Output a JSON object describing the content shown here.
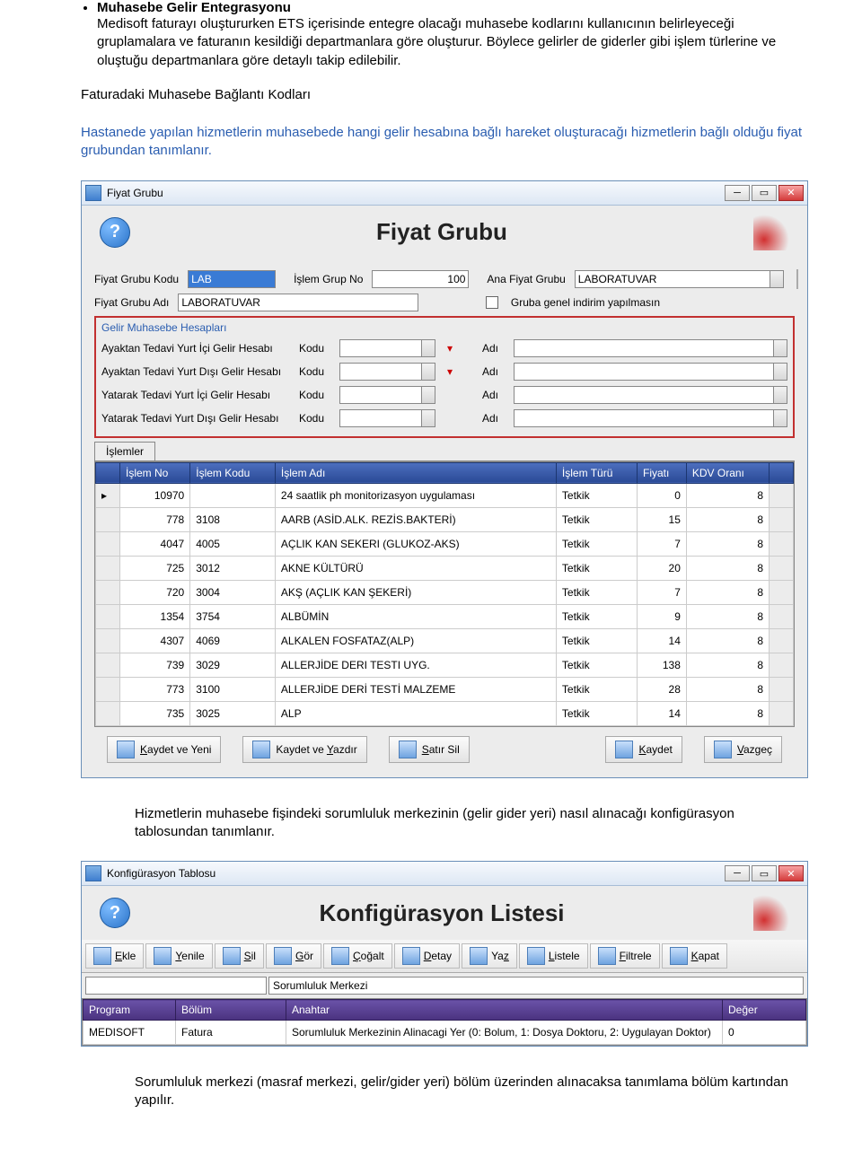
{
  "doc": {
    "heading": "Muhasebe Gelir Entegrasyonu",
    "para1": "Medisoft faturayı oluştururken ETS içerisinde entegre olacağı muhasebe kodlarını kullanıcının belirleyeceği gruplamalara ve faturanın kesildiği departmanlara göre oluşturur. Böylece gelirler de giderler gibi işlem türlerine ve oluştuğu departmanlara göre detaylı takip edilebilir.",
    "para2": "Faturadaki Muhasebe Bağlantı Kodları",
    "para3": "Hastanede yapılan hizmetlerin muhasebede hangi gelir hesabına bağlı hareket oluşturacağı hizmetlerin bağlı olduğu fiyat grubundan tanımlanır.",
    "para4": "Hizmetlerin muhasebe fişindeki sorumluluk merkezinin (gelir gider yeri) nasıl alınacağı konfigürasyon tablosundan tanımlanır.",
    "para5": "Sorumluluk merkezi (masraf merkezi, gelir/gider yeri) bölüm üzerinden alınacaksa tanımlama bölüm kartından yapılır."
  },
  "win1": {
    "title": "Fiyat Grubu",
    "bigTitle": "Fiyat Grubu",
    "labels": {
      "fiyatGrubuKodu": "Fiyat Grubu Kodu",
      "islemGrupNo": "İşlem Grup No",
      "anaFiyatGrubu": "Ana Fiyat Grubu",
      "fiyatGrubuAdi": "Fiyat Grubu Adı",
      "grubaIndirim": "Gruba genel indirim yapılmasın",
      "gelirHesaplari": "Gelir Muhasebe Hesapları",
      "ayaktanIci": "Ayaktan Tedavi Yurt İçi Gelir Hesabı",
      "ayaktanDisi": "Ayaktan Tedavi Yurt Dışı Gelir Hesabı",
      "yatarakIci": "Yatarak Tedavi Yurt İçi Gelir Hesabı",
      "yatarakDisi": "Yatarak Tedavi Yurt Dışı Gelir Hesabı",
      "kodu": "Kodu",
      "adi": "Adı",
      "islemler": "İşlemler"
    },
    "values": {
      "kodu": "LAB",
      "islemGrupNo": "100",
      "anaFiyatGrubu": "LABORATUVAR",
      "adi": "LABORATUVAR"
    },
    "gridHeaders": {
      "islemNo": "İşlem No",
      "islemKodu": "İşlem Kodu",
      "islemAdi": "İşlem Adı",
      "islemTuru": "İşlem Türü",
      "fiyati": "Fiyatı",
      "kdvOrani": "KDV Oranı"
    },
    "rows": [
      {
        "no": "10970",
        "kodu": "",
        "adi": "24 saatlik ph monitorizasyon uygulaması",
        "turu": "Tetkik",
        "fiyat": "0",
        "kdv": "8"
      },
      {
        "no": "778",
        "kodu": "3108",
        "adi": "AARB (ASİD.ALK. REZİS.BAKTERİ)",
        "turu": "Tetkik",
        "fiyat": "15",
        "kdv": "8"
      },
      {
        "no": "4047",
        "kodu": "4005",
        "adi": "AÇLIK KAN SEKERI (GLUKOZ-AKS)",
        "turu": "Tetkik",
        "fiyat": "7",
        "kdv": "8"
      },
      {
        "no": "725",
        "kodu": "3012",
        "adi": "AKNE KÜLTÜRÜ",
        "turu": "Tetkik",
        "fiyat": "20",
        "kdv": "8"
      },
      {
        "no": "720",
        "kodu": "3004",
        "adi": "AKŞ (AÇLIK KAN ŞEKERİ)",
        "turu": "Tetkik",
        "fiyat": "7",
        "kdv": "8"
      },
      {
        "no": "1354",
        "kodu": "3754",
        "adi": "ALBÜMİN",
        "turu": "Tetkik",
        "fiyat": "9",
        "kdv": "8"
      },
      {
        "no": "4307",
        "kodu": "4069",
        "adi": "ALKALEN FOSFATAZ(ALP)",
        "turu": "Tetkik",
        "fiyat": "14",
        "kdv": "8"
      },
      {
        "no": "739",
        "kodu": "3029",
        "adi": "ALLERJİDE DERI TESTI UYG.",
        "turu": "Tetkik",
        "fiyat": "138",
        "kdv": "8"
      },
      {
        "no": "773",
        "kodu": "3100",
        "adi": "ALLERJİDE DERİ TESTİ MALZEME",
        "turu": "Tetkik",
        "fiyat": "28",
        "kdv": "8"
      },
      {
        "no": "735",
        "kodu": "3025",
        "adi": "ALP",
        "turu": "Tetkik",
        "fiyat": "14",
        "kdv": "8"
      }
    ],
    "buttons": {
      "kaydetYeni": "Kaydet ve Yeni",
      "kaydetYazdir": "Kaydet ve Yazdır",
      "satirSil": "Satır Sil",
      "kaydet": "Kaydet",
      "vazgec": "Vazgeç"
    }
  },
  "win2": {
    "title": "Konfigürasyon Tablosu",
    "bigTitle": "Konfigürasyon Listesi",
    "toolbar": {
      "ekle": "Ekle",
      "yenile": "Yenile",
      "sil": "Sil",
      "gor": "Gör",
      "cogalt": "Çoğalt",
      "detay": "Detay",
      "yaz": "Yaz",
      "listele": "Listele",
      "filtrele": "Filtrele",
      "kapat": "Kapat"
    },
    "searchValue": "Sorumluluk Merkezi",
    "headers": {
      "program": "Program",
      "bolum": "Bölüm",
      "anahtar": "Anahtar",
      "deger": "Değer"
    },
    "row": {
      "program": "MEDISOFT",
      "bolum": "Fatura",
      "anahtar": "Sorumluluk Merkezinin Alinacagi Yer (0: Bolum, 1: Dosya Doktoru, 2: Uygulayan Doktor)",
      "deger": "0"
    }
  }
}
